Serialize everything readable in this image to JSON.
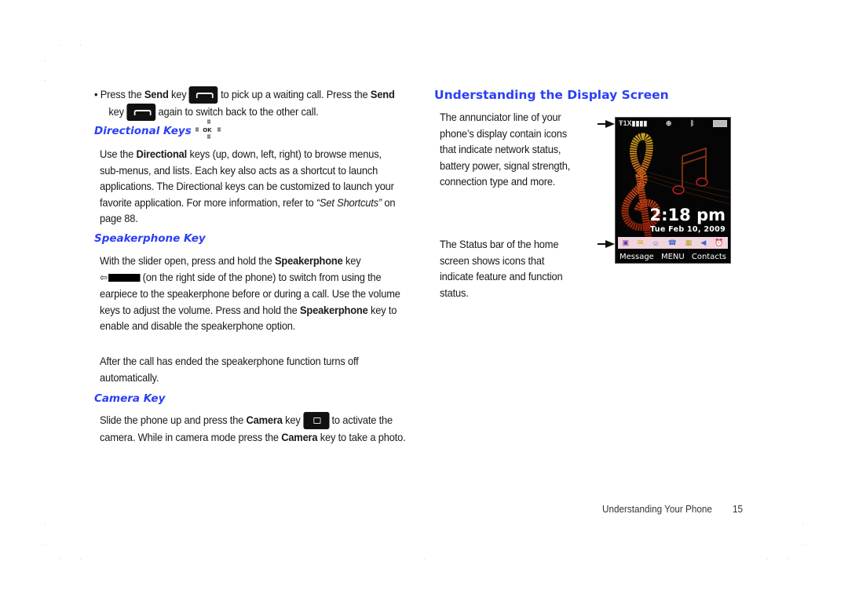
{
  "left_column": {
    "bullet": {
      "part1": "Press the ",
      "send_bold_1": "Send",
      "part2": " key ",
      "part3": " to pick up a waiting call. Press the ",
      "send_bold_2": "Send",
      "part4": "key ",
      "part5": " again to switch back to the other call."
    },
    "directional": {
      "heading": "Directional Keys",
      "icon_ok": "OK",
      "p_part1": "Use the ",
      "p_bold": "Directional",
      "p_part2": " keys (up, down, left, right) to browse menus, sub-menus, and lists. Each key also acts as a shortcut to launch applications. The Directional keys can be customized to launch your favorite application. For more information, refer to ",
      "p_link": "“Set Shortcuts”",
      "p_part3": "  on page 88."
    },
    "speakerphone": {
      "heading": "Speakerphone Key",
      "p1_part1": "With the slider open, press and hold the ",
      "p1_bold1": "Speakerphone",
      "p1_part2": " key",
      "p1_part3": " (on the right side of the phone) to switch from using the earpiece to the speakerphone before or during a call. Use the volume keys to adjust the volume. Press and hold the ",
      "p1_bold2": "Speakerphone",
      "p1_part4": " key to enable and disable the speakerphone option.",
      "p2": "After the call has ended the speakerphone function turns off automatically."
    },
    "camera": {
      "heading": "Camera Key",
      "p_part1": "Slide the phone up and press the ",
      "p_bold1": "Camera",
      "p_part2": " key ",
      "p_part3": " to activate the camera. While in camera mode press the ",
      "p_bold2": "Camera",
      "p_part4": " key to take a photo."
    }
  },
  "right_column": {
    "heading": "Understanding the Display Screen",
    "annunciator_text": "The annunciator line of your phone’s display contain icons that indicate network status, battery power, signal strength, connection type and more.",
    "status_text": "The Status bar of the home screen shows icons that indicate feature and function status.",
    "phone_screen": {
      "network": "1X",
      "time": "2:18 pm",
      "date": "Tue Feb 10, 2009",
      "softkeys": [
        "Message",
        "MENU",
        "Contacts"
      ],
      "status_icons": [
        "vibrate-icon",
        "message-icon",
        "contacts-icon",
        "call-icon",
        "calendar-icon",
        "speaker-icon",
        "alarm-icon"
      ],
      "annunciator_icons": [
        "signal-icon",
        "network-1x-icon",
        "location-icon",
        "bluetooth-icon",
        "battery-icon"
      ]
    }
  },
  "footer": {
    "section": "Understanding Your Phone",
    "page_number": "15"
  },
  "colors": {
    "heading_blue": "#2a3ff5",
    "status_bar_pink": "#f0d4de"
  }
}
